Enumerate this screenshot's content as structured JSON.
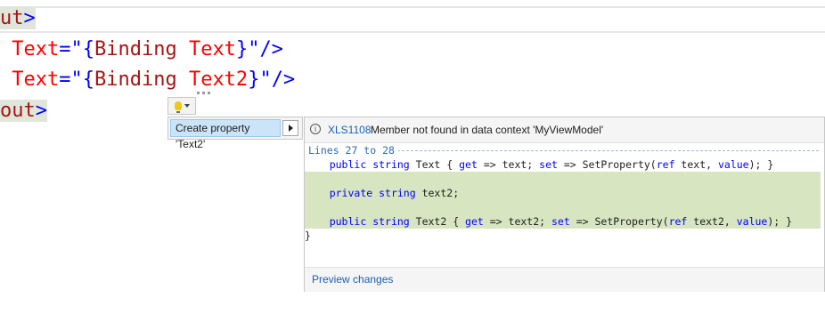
{
  "editor": {
    "lines": [
      {
        "tag": "ut",
        "end": ">"
      },
      {
        "attr": "Text",
        "eq": "=",
        "q1": "\"",
        "brace_open": "{",
        "binding": "Binding",
        "path": " Text",
        "brace_close": "}",
        "q2": "\"",
        "close": "/>"
      },
      {
        "attr": "Text",
        "eq": "=",
        "q1": "\"",
        "brace_open": "{",
        "binding": "Binding",
        "path": " Text2",
        "brace_close": "}",
        "q2": "\"",
        "close": "/>"
      },
      {
        "tag": "out",
        "end": ">"
      }
    ]
  },
  "quick_actions": {
    "bulb_icon": "lightbulb-icon",
    "menu_item": "Create property 'Text2'"
  },
  "preview": {
    "error_code": "XLS1108",
    "error_message": "Member not found in data context 'MyViewModel'",
    "lines_label": "Lines 27 to 28",
    "code": {
      "l1_indent": "    ",
      "l1_kw1": "public",
      "l1_kw2": "string",
      "l1_rest1": " Text { ",
      "l1_get": "get",
      "l1_rest2": " => text; ",
      "l1_set": "set",
      "l1_rest3": " => SetProperty(",
      "l1_ref": "ref",
      "l1_rest4": " text, ",
      "l1_value": "value",
      "l1_rest5": "); }",
      "l2_kw1": "private",
      "l2_kw2": "string",
      "l2_rest": " text2;",
      "l3_kw1": "public",
      "l3_kw2": "string",
      "l3_rest1": " Text2 { ",
      "l3_get": "get",
      "l3_rest2": " => text2; ",
      "l3_set": "set",
      "l3_rest3": " => SetProperty(",
      "l3_ref": "ref",
      "l3_rest4": " text2, ",
      "l3_value": "value",
      "l3_rest5": "); }",
      "l4": "}"
    },
    "footer_link": "Preview changes"
  },
  "colors": {
    "keyword": "#0000ff",
    "xml_tag": "#a31515",
    "xml_attr": "#ff0000",
    "added_line": "#d8e5c1",
    "link": "#1a5fb4"
  }
}
